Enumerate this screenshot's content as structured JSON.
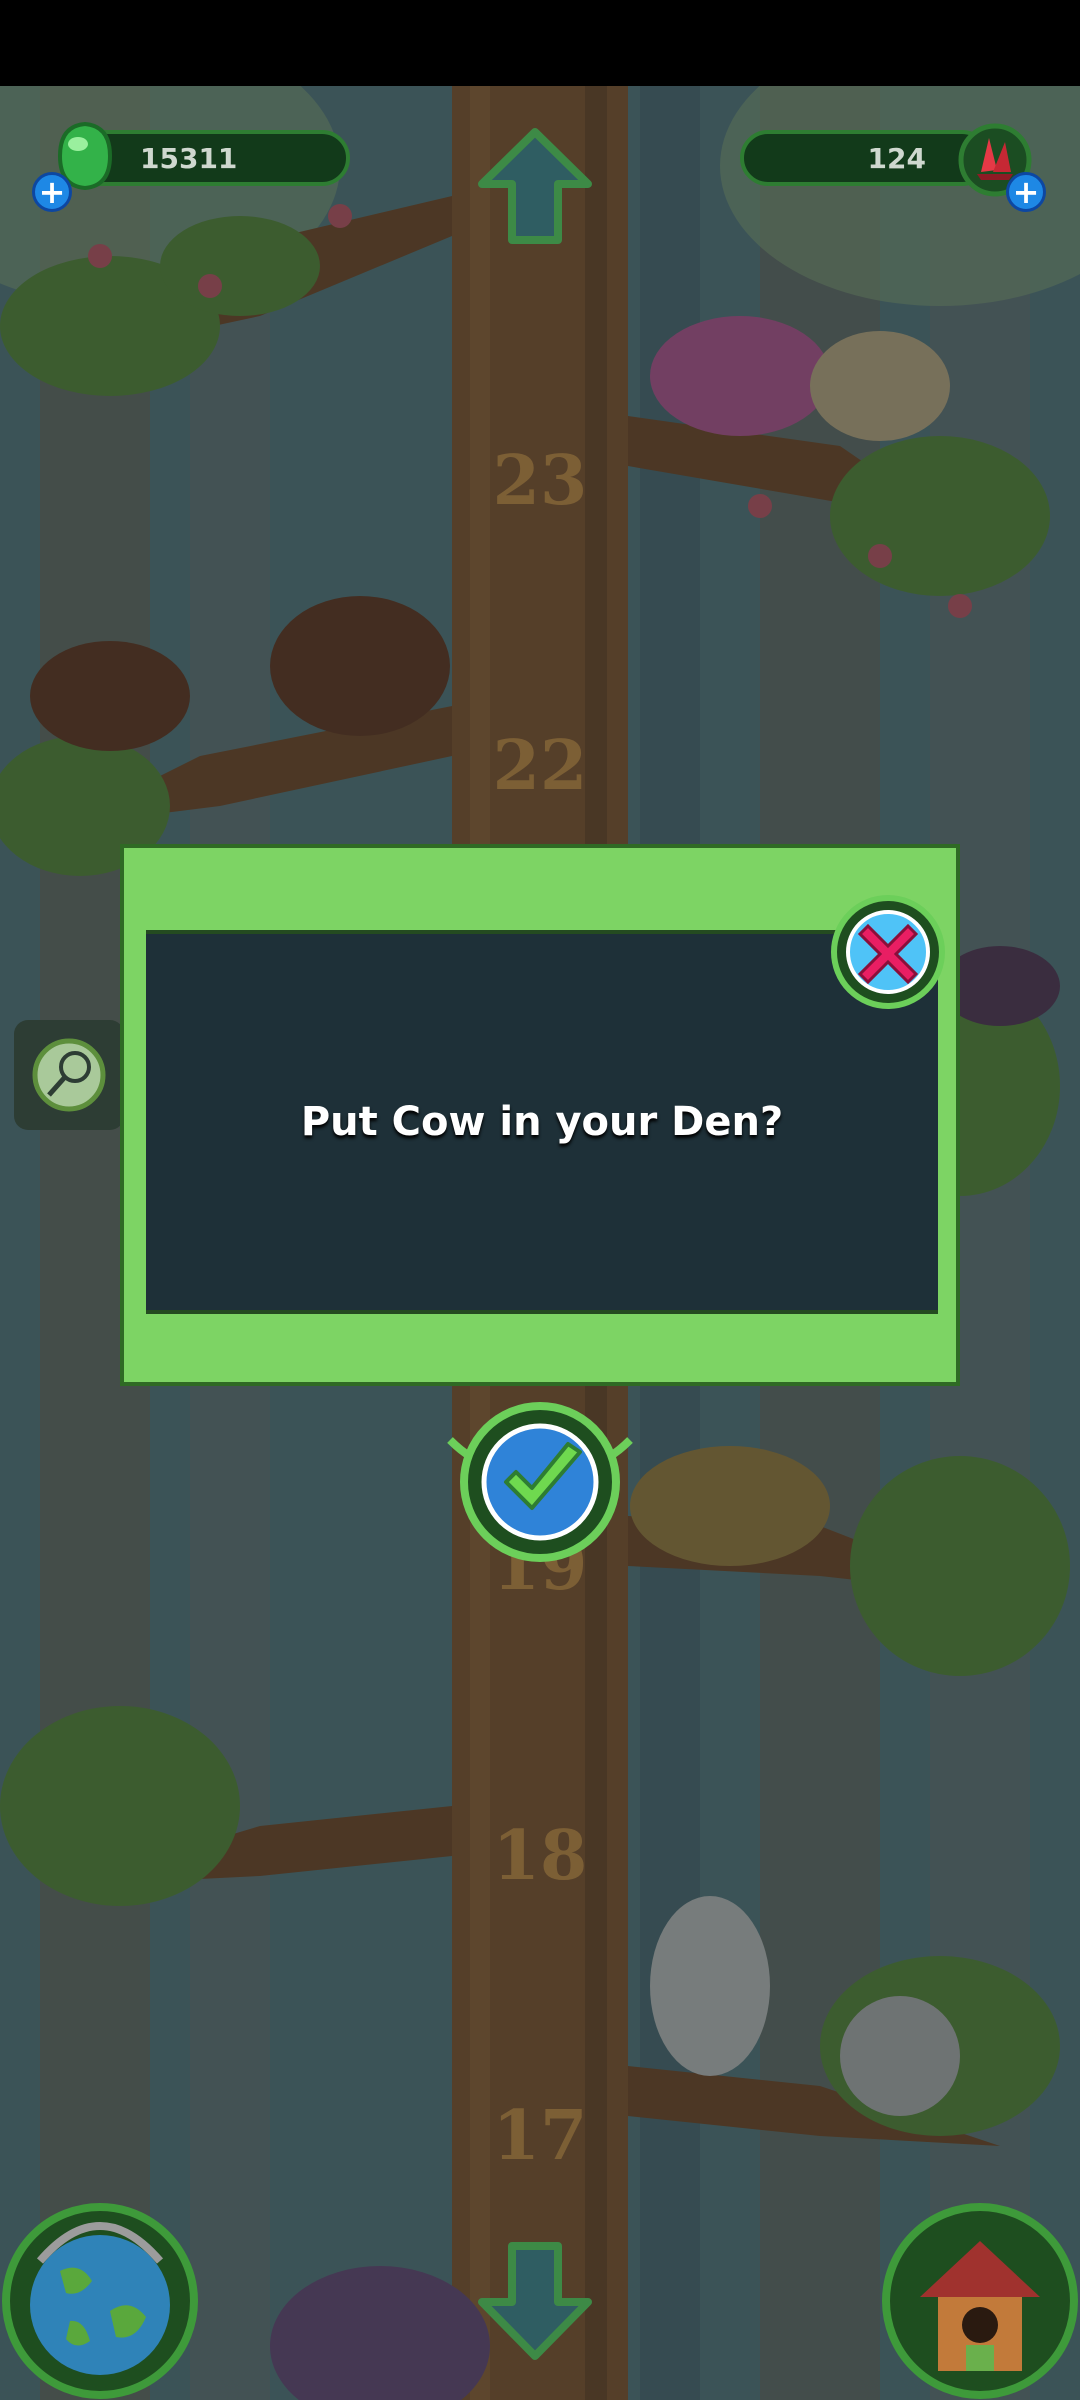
{
  "hud": {
    "coins": "15311",
    "gems": "124"
  },
  "tree": {
    "levels": [
      "23",
      "22",
      "19",
      "18",
      "17"
    ]
  },
  "dialog": {
    "message": "Put Cow in your Den?"
  },
  "icons": {
    "coin": "green-coin-icon",
    "gem": "red-gem-icon",
    "up": "up-arrow-icon",
    "down": "down-arrow-icon",
    "net": "net-icon",
    "globe": "globe-icon",
    "den": "den-house-icon",
    "close": "close-x-icon",
    "confirm": "checkmark-icon"
  },
  "colors": {
    "dialog_frame": "#7dd464",
    "dialog_body": "#1e3038",
    "close_accent": "#e91e63",
    "confirm_accent": "#43a047"
  }
}
